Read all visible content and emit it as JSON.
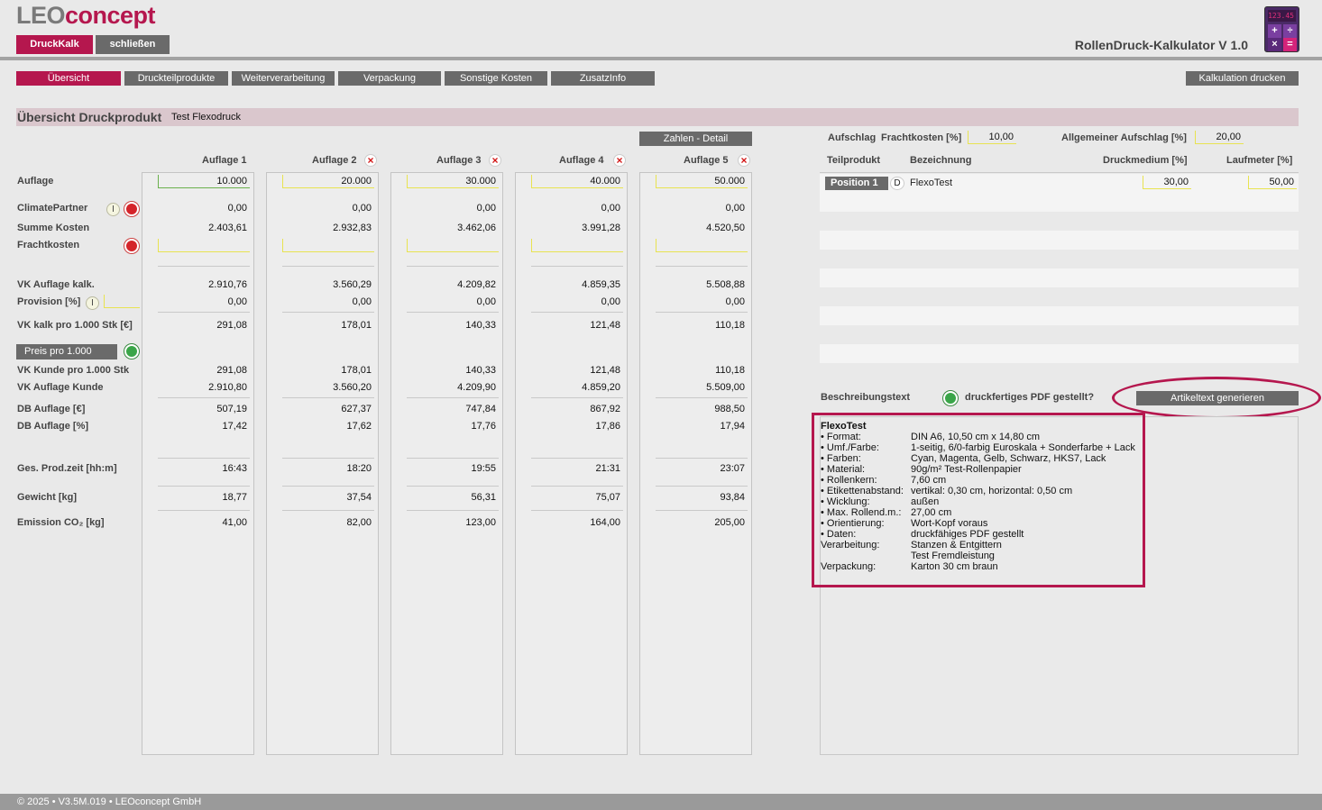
{
  "header": {
    "logo_leo": "LEO",
    "logo_concept": "concept",
    "btn_druckkalk": "DruckKalk",
    "btn_schliessen": "schließen",
    "app_title": "RollenDruck-Kalkulator V 1.0",
    "calc_display": "123.45"
  },
  "tabs": [
    "Übersicht",
    "Druckteilprodukte",
    "Weiterverarbeitung",
    "Verpackung",
    "Sonstige Kosten",
    "ZusatzInfo"
  ],
  "print_button": "Kalkulation drucken",
  "section": {
    "title": "Übersicht Druckprodukt",
    "product": "Test Flexodruck"
  },
  "zahlen_detail": "Zahlen - Detail",
  "columns": [
    "Auflage 1",
    "Auflage 2",
    "Auflage 3",
    "Auflage 4",
    "Auflage 5"
  ],
  "labels": {
    "auflage": "Auflage",
    "climate": "ClimatePartner",
    "summe": "Summe Kosten",
    "fracht": "Frachtkosten",
    "vk_kalk": "VK Auflage kalk.",
    "provision": "Provision [%]",
    "vk_pro": "VK kalk pro 1.000 Stk [€]",
    "preis_btn": "Preis pro 1.000",
    "vk_kunde_pro": "VK Kunde pro 1.000 Stk",
    "vk_kunde": "VK Auflage Kunde",
    "db_eur": "DB Auflage [€]",
    "db_pct": "DB Auflage [%]",
    "prodzeit": "Ges. Prod.zeit [hh:m]",
    "gewicht": "Gewicht [kg]",
    "emission": "Emission CO₂ [kg]"
  },
  "values": {
    "auflage": [
      "10.000",
      "20.000",
      "30.000",
      "40.000",
      "50.000"
    ],
    "climate": [
      "0,00",
      "0,00",
      "0,00",
      "0,00",
      "0,00"
    ],
    "summe": [
      "2.403,61",
      "2.932,83",
      "3.462,06",
      "3.991,28",
      "4.520,50"
    ],
    "vk_kalk": [
      "2.910,76",
      "3.560,29",
      "4.209,82",
      "4.859,35",
      "5.508,88"
    ],
    "provision": [
      "0,00",
      "0,00",
      "0,00",
      "0,00",
      "0,00"
    ],
    "vk_pro": [
      "291,08",
      "178,01",
      "140,33",
      "121,48",
      "110,18"
    ],
    "vk_kunde_pro": [
      "291,08",
      "178,01",
      "140,33",
      "121,48",
      "110,18"
    ],
    "vk_kunde": [
      "2.910,80",
      "3.560,20",
      "4.209,90",
      "4.859,20",
      "5.509,00"
    ],
    "db_eur": [
      "507,19",
      "627,37",
      "747,84",
      "867,92",
      "988,50"
    ],
    "db_pct": [
      "17,42",
      "17,62",
      "17,76",
      "17,86",
      "17,94"
    ],
    "prodzeit": [
      "16:43",
      "18:20",
      "19:55",
      "21:31",
      "23:07"
    ],
    "gewicht": [
      "18,77",
      "37,54",
      "56,31",
      "75,07",
      "93,84"
    ],
    "emission": [
      "41,00",
      "82,00",
      "123,00",
      "164,00",
      "205,00"
    ]
  },
  "right": {
    "aufschlag": "Aufschlag",
    "frachtkosten_pct": "Frachtkosten [%]",
    "frachtkosten_val": "10,00",
    "allg_aufschlag": "Allgemeiner Aufschlag [%]",
    "allg_val": "20,00",
    "h_teilprodukt": "Teilprodukt",
    "h_bezeichnung": "Bezeichnung",
    "h_druckmedium": "Druckmedium [%]",
    "h_laufmeter": "Laufmeter [%]",
    "pos_btn": "Position 1",
    "pos_type": "D",
    "pos_name": "FlexoTest",
    "pos_druck": "30,00",
    "pos_lauf": "50,00",
    "beschreibung": "Beschreibungstext",
    "pdf_q": "druckfertiges PDF gestellt?",
    "gen_btn": "Artikeltext generieren"
  },
  "description": {
    "title": "FlexoTest",
    "lines": [
      [
        "• Format:",
        "DIN A6, 10,50 cm x 14,80 cm"
      ],
      [
        "• Umf./Farbe:",
        "1-seitig, 6/0-farbig Euroskala + Sonderfarbe + Lack"
      ],
      [
        "• Farben:",
        "Cyan, Magenta, Gelb, Schwarz, HKS7, Lack"
      ],
      [
        "• Material:",
        "90g/m² Test-Rollenpapier"
      ],
      [
        "• Rollenkern:",
        "7,60 cm"
      ],
      [
        "• Etikettenabstand:",
        "vertikal: 0,30 cm, horizontal: 0,50 cm"
      ],
      [
        "• Wicklung:",
        "außen"
      ],
      [
        "• Max. Rollend.m.:",
        "27,00 cm"
      ],
      [
        "• Orientierung:",
        "Wort-Kopf voraus"
      ],
      [
        "• Daten:",
        "druckfähiges PDF gestellt"
      ],
      [
        "Verarbeitung:",
        "Stanzen & Entgittern"
      ],
      [
        "",
        "Test Fremdleistung"
      ],
      [
        "Verpackung:",
        "Karton 30 cm braun"
      ]
    ]
  },
  "footer": "© 2025 • V3.5M.019 • LEOconcept GmbH"
}
